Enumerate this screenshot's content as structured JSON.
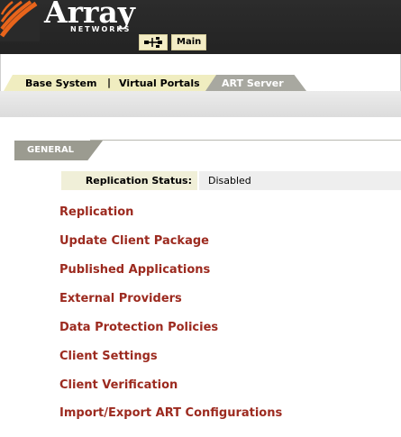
{
  "header": {
    "brand_name": "Array",
    "brand_sub": "NETWORKS",
    "home_icon": "network-icon",
    "main_button_label": "Main"
  },
  "tabs": [
    {
      "label": "Base System",
      "active": false
    },
    {
      "label": "Virtual Portals",
      "active": false
    },
    {
      "label": "ART Server",
      "active": true
    }
  ],
  "tab_separator": "|",
  "section": {
    "title": "GENERAL",
    "status_label": "Replication Status:",
    "status_value": "Disabled"
  },
  "links": [
    "Replication",
    "Update Client Package",
    "Published Applications",
    "External Providers",
    "Data Protection Policies",
    "Client Settings",
    "Client Verification",
    "Import/Export ART Configurations"
  ],
  "colors": {
    "header_bg": "#2a2a2a",
    "brand_orange": "#e8641b",
    "tab_light": "#f0edc0",
    "tab_dark": "#a8a8a0",
    "link_color": "#9c2a1f",
    "section_head": "#9b9b90"
  }
}
